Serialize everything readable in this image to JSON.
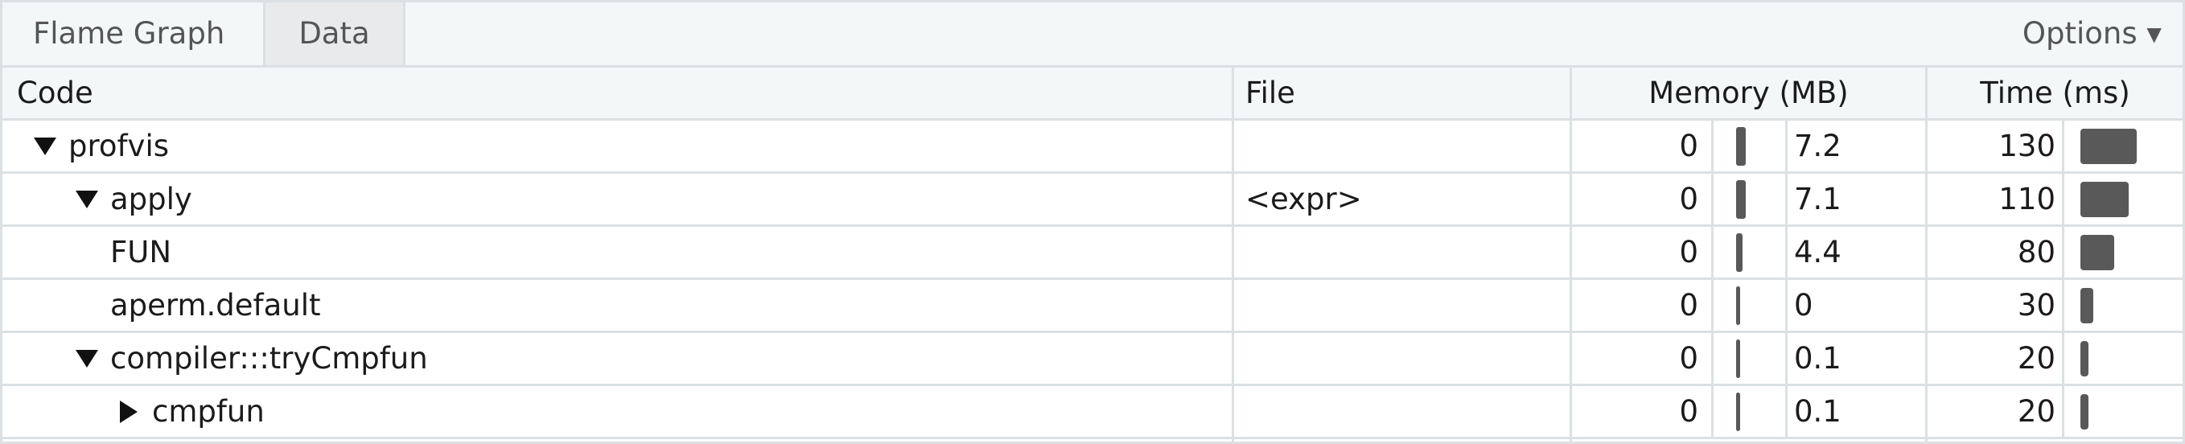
{
  "tabs": {
    "flame_graph": "Flame Graph",
    "data": "Data"
  },
  "options_label": "Options ▾",
  "columns": {
    "code": "Code",
    "file": "File",
    "memory": "Memory (MB)",
    "time": "Time (ms)"
  },
  "rows": [
    {
      "name": "profvis",
      "file": "",
      "mem_dealloc": "0",
      "mem_alloc": "7.2",
      "time": "130",
      "expanded": true
    },
    {
      "name": "apply",
      "file": "<expr>",
      "mem_dealloc": "0",
      "mem_alloc": "7.1",
      "time": "110",
      "expanded": true
    },
    {
      "name": "FUN",
      "file": "",
      "mem_dealloc": "0",
      "mem_alloc": "4.4",
      "time": "80"
    },
    {
      "name": "aperm.default",
      "file": "",
      "mem_dealloc": "0",
      "mem_alloc": "0",
      "time": "30"
    },
    {
      "name": "compiler:::tryCmpfun",
      "file": "",
      "mem_dealloc": "0",
      "mem_alloc": "0.1",
      "time": "20",
      "expanded": true
    },
    {
      "name": "cmpfun",
      "file": "",
      "mem_dealloc": "0",
      "mem_alloc": "0.1",
      "time": "20",
      "expanded": false
    }
  ],
  "colors": {
    "bar": "#595959",
    "header_bg": "#f4f7f8",
    "border": "#dbe1e3",
    "active_tab": "#e8eaeb"
  }
}
